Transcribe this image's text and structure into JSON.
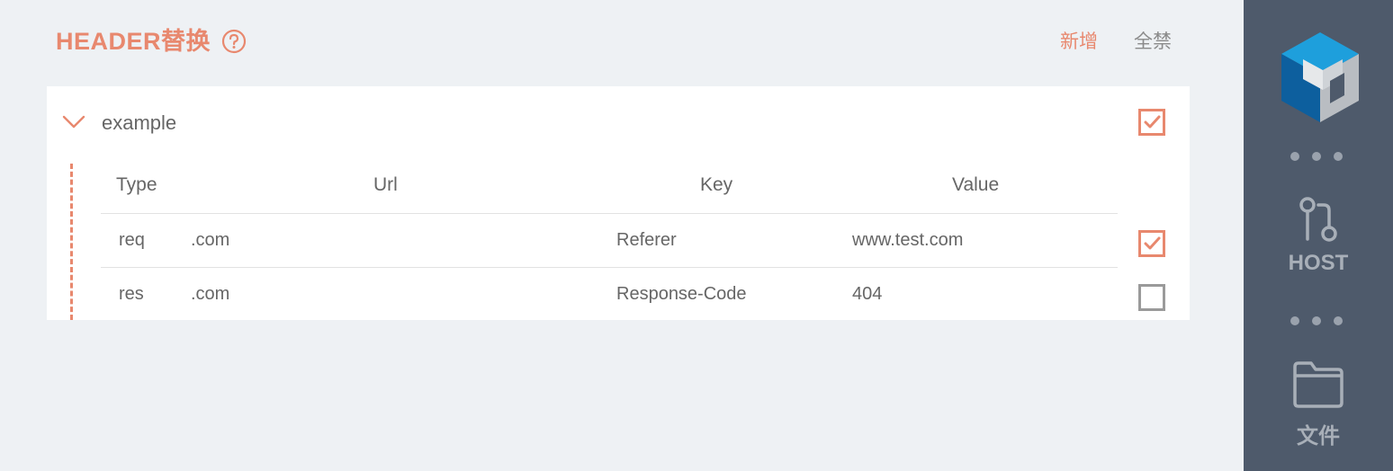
{
  "header": {
    "title": "HEADER替换",
    "add_label": "新增",
    "disable_all_label": "全禁"
  },
  "rule": {
    "name": "example",
    "enabled": true,
    "columns": {
      "type": "Type",
      "url": "Url",
      "key": "Key",
      "value": "Value"
    },
    "rows": [
      {
        "type": "req",
        "url": ".com",
        "key": "Referer",
        "value": "www.test.com",
        "enabled": true
      },
      {
        "type": "res",
        "url": ".com",
        "key": "Response-Code",
        "value": "404",
        "enabled": false
      }
    ]
  },
  "sidebar": {
    "host_label": "HOST",
    "file_label": "文件"
  },
  "colors": {
    "accent": "#e8886e",
    "sidebar_bg": "#4e5a6b",
    "page_bg": "#eef1f4"
  }
}
